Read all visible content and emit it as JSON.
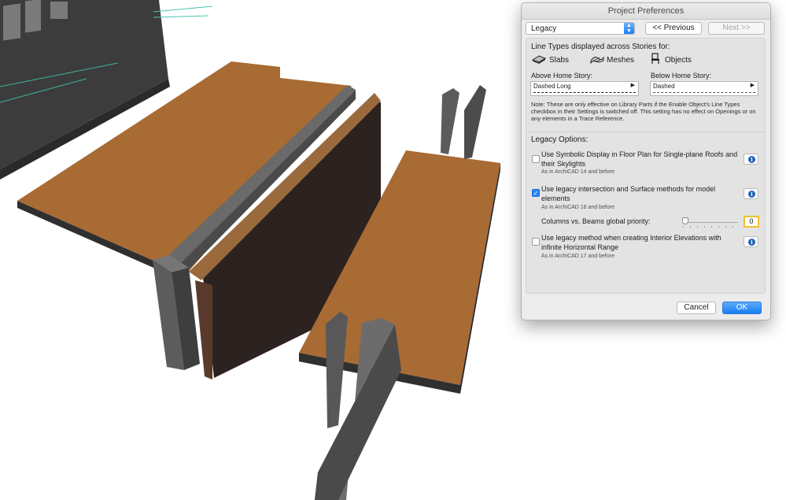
{
  "dialog": {
    "title": "Project Preferences",
    "preset": "Legacy",
    "prev_label": "<< Previous",
    "next_label": "Next >>",
    "cancel_label": "Cancel",
    "ok_label": "OK"
  },
  "line_types": {
    "heading": "Line Types displayed across Stories for:",
    "types": [
      {
        "label": "Slabs",
        "icon": "slab-icon"
      },
      {
        "label": "Meshes",
        "icon": "mesh-icon"
      },
      {
        "label": "Objects",
        "icon": "chair-icon"
      }
    ],
    "above_label": "Above Home Story:",
    "above_value": "Dashed Long",
    "below_label": "Below Home Story:",
    "below_value": "Dashed",
    "note": "Note: These are only effective on Library Parts if the Enable Object's Line Types checkbox in their Settings is switched off. This setting has no effect on Openings or on any elements in a Trace Reference."
  },
  "legacy": {
    "heading": "Legacy Options:",
    "options": [
      {
        "label": "Use Symbolic Display in Floor Plan for Single-plane Roofs and their Skylights",
        "sub": "As in ArchiCAD 14 and before",
        "checked": false
      },
      {
        "label": "Use legacy intersection and Surface methods for model elements",
        "sub": "As in ArchiCAD 16 and before",
        "checked": true
      },
      {
        "label": "Use legacy method when creating Interior Elevations with infinite Horizontal Range",
        "sub": "As in ArchiCAD 17 and before",
        "checked": false
      }
    ],
    "priority_label": "Columns vs. Beams global priority:",
    "priority_value": "0"
  },
  "colors": {
    "accent": "#1a7ff5",
    "slab_top": "#a86b34",
    "wall": "#5a5a5a",
    "brick": "#3a2a26"
  }
}
